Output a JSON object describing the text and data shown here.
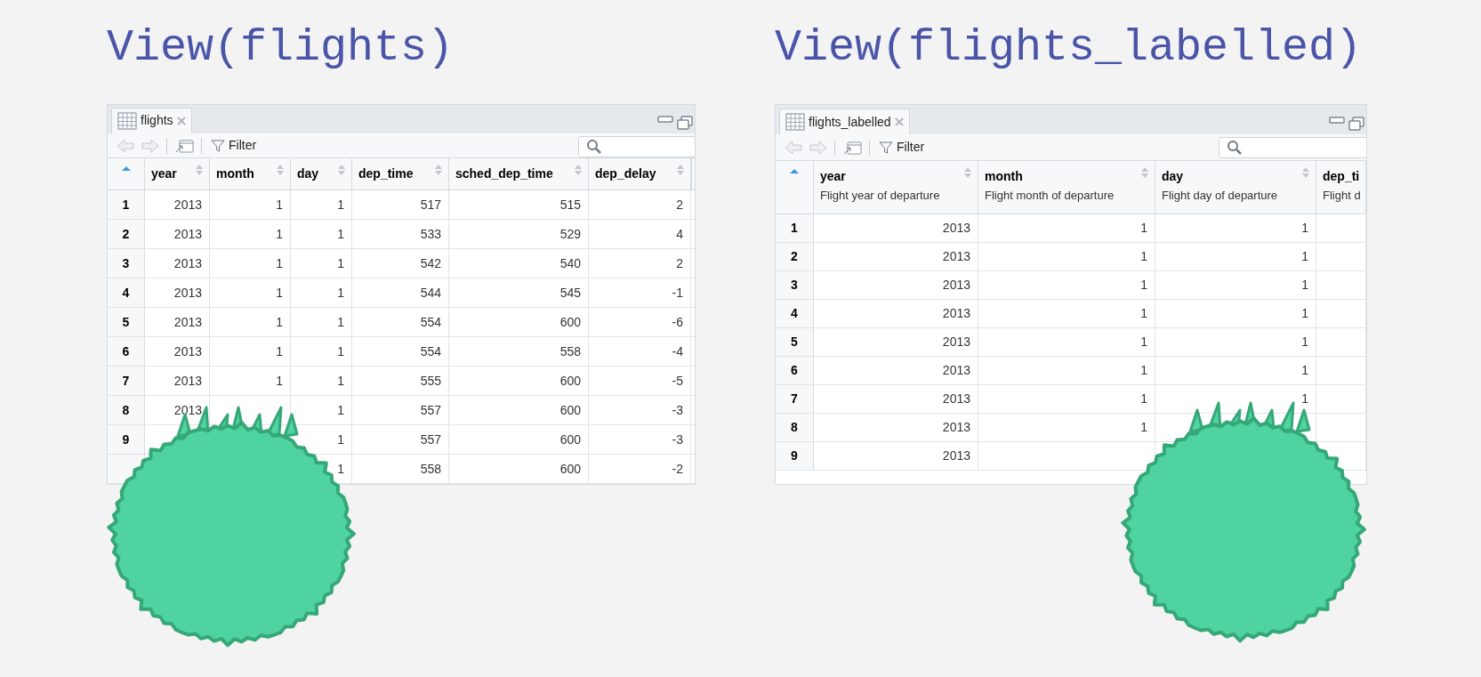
{
  "panels": [
    {
      "title": "View(flights)",
      "kind": "plain",
      "viewer": {
        "tab": {
          "label": "flights",
          "selected": true
        },
        "filter_label": "Filter",
        "columns": [
          {
            "name": "year"
          },
          {
            "name": "month"
          },
          {
            "name": "day"
          },
          {
            "name": "dep_time"
          },
          {
            "name": "sched_dep_time"
          },
          {
            "name": "dep_delay"
          }
        ],
        "rows": [
          {
            "index": "1",
            "cells": [
              "2013",
              "1",
              "1",
              "517",
              "515",
              "2"
            ]
          },
          {
            "index": "2",
            "cells": [
              "2013",
              "1",
              "1",
              "533",
              "529",
              "4"
            ]
          },
          {
            "index": "3",
            "cells": [
              "2013",
              "1",
              "1",
              "542",
              "540",
              "2"
            ]
          },
          {
            "index": "4",
            "cells": [
              "2013",
              "1",
              "1",
              "544",
              "545",
              "-1"
            ]
          },
          {
            "index": "5",
            "cells": [
              "2013",
              "1",
              "1",
              "554",
              "600",
              "-6"
            ]
          },
          {
            "index": "6",
            "cells": [
              "2013",
              "1",
              "1",
              "554",
              "558",
              "-4"
            ]
          },
          {
            "index": "7",
            "cells": [
              "2013",
              "1",
              "1",
              "555",
              "600",
              "-5"
            ]
          },
          {
            "index": "8",
            "cells": [
              "2013",
              null,
              "1",
              "557",
              "600",
              "-3"
            ]
          },
          {
            "index": "9",
            "cells": [
              null,
              null,
              "1",
              "557",
              "600",
              "-3"
            ]
          },
          {
            "index": null,
            "cells": [
              null,
              null,
              "1",
              "558",
              "600",
              "-2"
            ]
          }
        ]
      }
    },
    {
      "title": "View(flights_labelled)",
      "kind": "labelled",
      "viewer": {
        "tab": {
          "label": "flights_labelled",
          "selected": true
        },
        "filter_label": "Filter",
        "columns": [
          {
            "name": "year",
            "label": "Flight year of departure"
          },
          {
            "name": "month",
            "label": "Flight month of departure"
          },
          {
            "name": "day",
            "label": "Flight day of departure"
          },
          {
            "name": "dep_ti",
            "label": "Flight d"
          }
        ],
        "rows": [
          {
            "index": "1",
            "cells": [
              "2013",
              "1",
              "1"
            ]
          },
          {
            "index": "2",
            "cells": [
              "2013",
              "1",
              "1"
            ]
          },
          {
            "index": "3",
            "cells": [
              "2013",
              "1",
              "1"
            ]
          },
          {
            "index": "4",
            "cells": [
              "2013",
              "1",
              "1"
            ]
          },
          {
            "index": "5",
            "cells": [
              "2013",
              "1",
              "1"
            ]
          },
          {
            "index": "6",
            "cells": [
              "2013",
              "1",
              "1"
            ]
          },
          {
            "index": "7",
            "cells": [
              "2013",
              "1",
              "1"
            ]
          },
          {
            "index": "8",
            "cells": [
              "2013",
              "1",
              null
            ]
          },
          {
            "index": "9",
            "cells": [
              "2013",
              null,
              null
            ]
          }
        ]
      }
    }
  ]
}
